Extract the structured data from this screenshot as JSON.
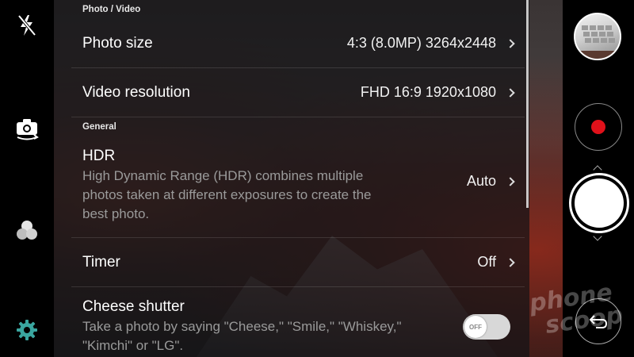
{
  "sections": {
    "photo_video": "Photo / Video",
    "general": "General"
  },
  "rows": {
    "photo_size": {
      "title": "Photo size",
      "value": "4:3 (8.0MP) 3264x2448"
    },
    "video_resolution": {
      "title": "Video resolution",
      "value": "FHD 16:9 1920x1080"
    },
    "hdr": {
      "title": "HDR",
      "desc_lines": [
        "High Dynamic Range (HDR) combines multiple",
        "photos taken at different exposures to create the",
        "best photo."
      ],
      "value": "Auto"
    },
    "timer": {
      "title": "Timer",
      "value": "Off"
    },
    "cheese_shutter": {
      "title": "Cheese shutter",
      "desc_lines": [
        "Take a photo by saying \"Cheese,\" \"Smile,\" \"Whiskey,\"",
        "\"Kimchi\" or \"LG\"."
      ],
      "toggle_label": "OFF"
    }
  },
  "left_rail_icons": [
    "flash-off-icon",
    "switch-camera-icon",
    "filter-icon",
    "settings-icon"
  ],
  "right_rail_icons": [
    "gallery-thumbnail",
    "record-icon",
    "shutter-button",
    "back-icon"
  ],
  "watermark": [
    "phone",
    "scoop"
  ],
  "colors": {
    "accent": "#3aa6a0",
    "record": "#e0111a"
  }
}
